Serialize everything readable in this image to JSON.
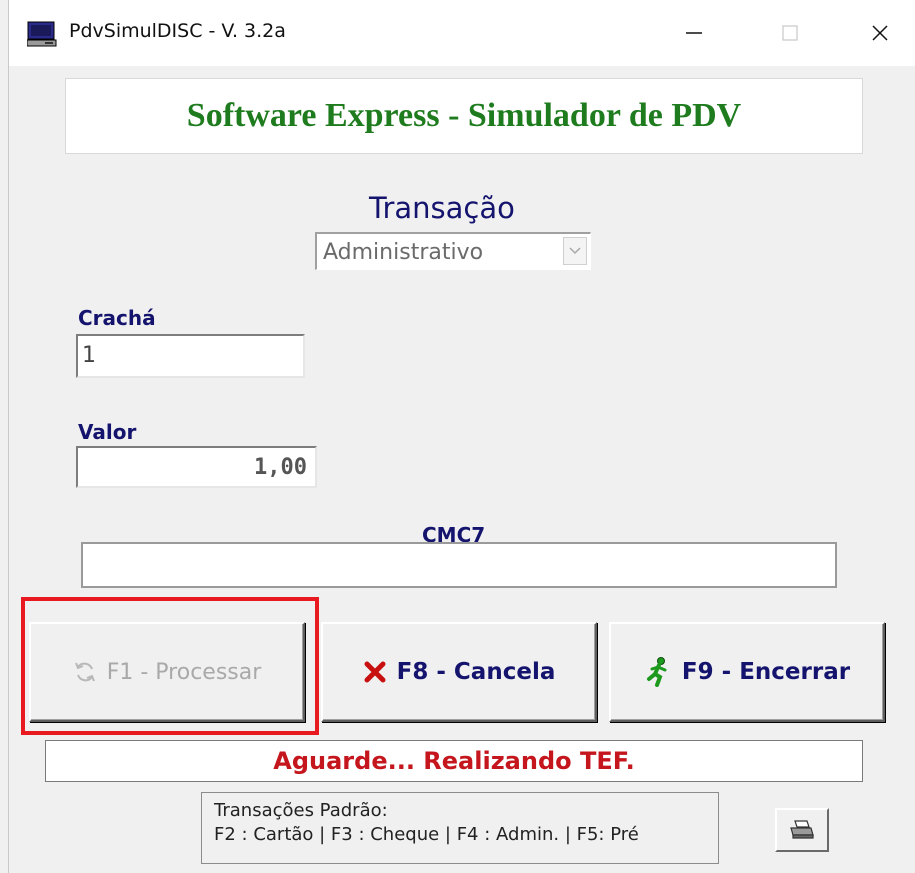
{
  "window": {
    "title": "PdvSimulDISC - V. 3.2a",
    "minimize": "—",
    "maximize": "☐",
    "close": "✕"
  },
  "header": {
    "title": "Software Express - Simulador de PDV"
  },
  "transacao": {
    "label": "Transação",
    "selected": "Administrativo"
  },
  "cracha": {
    "label": "Crachá",
    "value": "1"
  },
  "valor": {
    "label": "Valor",
    "value": "1,00"
  },
  "cmc7": {
    "label": "CMC7",
    "value": ""
  },
  "buttons": {
    "f1": "F1 - Processar",
    "f8": "F8 - Cancela",
    "f9": "F9 - Encerrar"
  },
  "status": {
    "text": "Aguarde... Realizando TEF."
  },
  "hint": {
    "line1": "Transações Padrão:",
    "line2": "F2 : Cartão  |  F3 : Cheque  |  F4 : Admin.  |  F5: Pré"
  },
  "colors": {
    "header_text": "#1e7b1e",
    "label_text": "#14146e",
    "status_text": "#c4161c",
    "highlight": "#e8191f"
  },
  "icons": {
    "app": "computer-icon",
    "f1": "refresh-icon",
    "f8": "red-x-icon",
    "f9": "running-man-icon",
    "print": "printer-icon"
  }
}
